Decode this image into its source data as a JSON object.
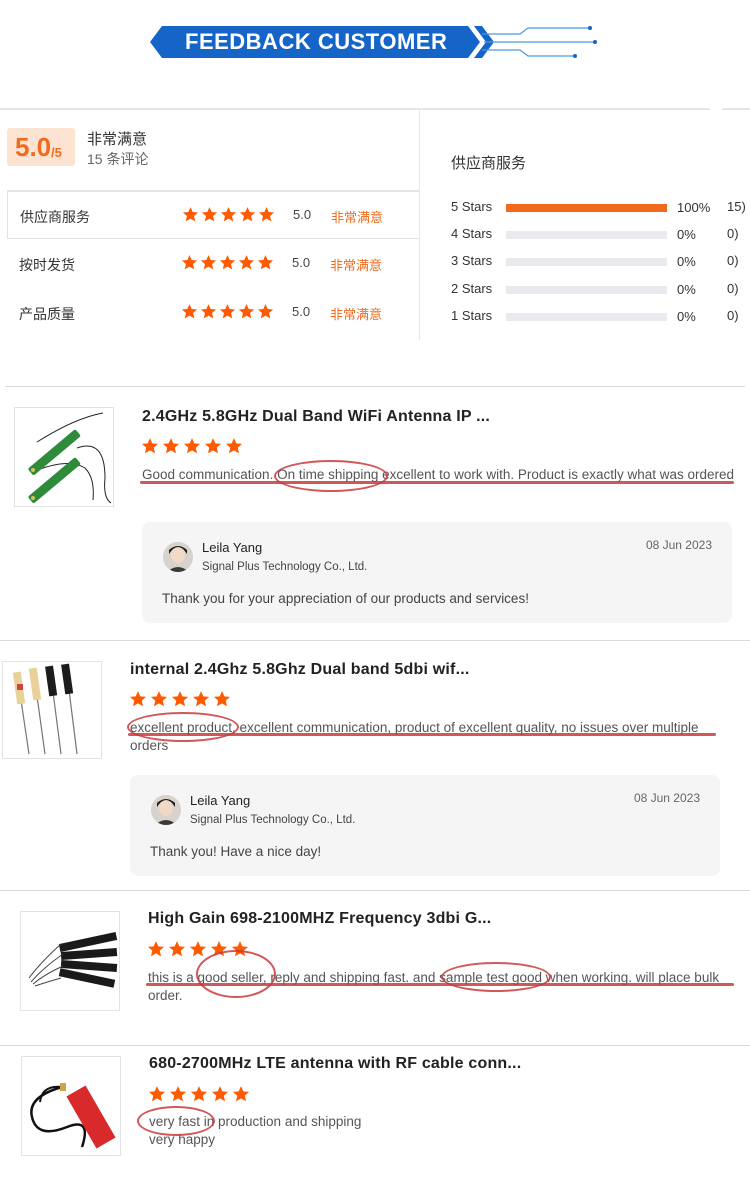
{
  "banner": {
    "title": "FEEDBACK CUSTOMER"
  },
  "summary": {
    "score": "5.0",
    "score_max": "/5",
    "rating_text": "非常满意",
    "review_count": "15 条评论"
  },
  "categories": [
    {
      "label": "供应商服务",
      "score": "5.0",
      "text": "非常满意",
      "stars": 5
    },
    {
      "label": "按时发货",
      "score": "5.0",
      "text": "非常满意",
      "stars": 5
    },
    {
      "label": "产品质量",
      "score": "5.0",
      "text": "非常满意",
      "stars": 5
    }
  ],
  "distribution": {
    "title": "供应商服务",
    "rows": [
      {
        "label": "5 Stars",
        "pct": "100%",
        "fraction": 1.0,
        "count_cut": "15)"
      },
      {
        "label": "4 Stars",
        "pct": "0%",
        "fraction": 0,
        "count_cut": "0)"
      },
      {
        "label": "3 Stars",
        "pct": "0%",
        "fraction": 0,
        "count_cut": "0)"
      },
      {
        "label": "2 Stars",
        "pct": "0%",
        "fraction": 0,
        "count_cut": "0)"
      },
      {
        "label": "1 Stars",
        "pct": "0%",
        "fraction": 0,
        "count_cut": "0)"
      }
    ]
  },
  "reviews": [
    {
      "title": "2.4GHz 5.8GHz Dual Band WiFi Antenna IP ...",
      "stars": 5,
      "text": "Good communication. On time shipping excellent to work with. Product is exactly what was ordered",
      "reply": {
        "name": "Leila Yang",
        "company": "Signal Plus Technology Co., Ltd.",
        "date": "08 Jun 2023",
        "text": "Thank you for your appreciation of our products and services!"
      }
    },
    {
      "title": "internal 2.4Ghz 5.8Ghz Dual band 5dbi wif...",
      "stars": 5,
      "text": "excellent product, excellent communication, product of excellent quality, no issues over multiple orders",
      "reply": {
        "name": "Leila Yang",
        "company": "Signal Plus Technology Co., Ltd.",
        "date": "08 Jun 2023",
        "text": "Thank you! Have a nice day!"
      }
    },
    {
      "title": "High Gain 698-2100MHZ Frequency 3dbi G...",
      "stars": 5,
      "text": "this is a good seller, reply and shipping fast. and sample test good when working. will place bulk order."
    },
    {
      "title": "680-2700MHz LTE antenna with RF cable conn...",
      "stars": 5,
      "text": "very fast in production and shipping very happy"
    }
  ],
  "colors": {
    "accent": "#f26b1d",
    "star": "#ff5a00",
    "banner": "#1565c8",
    "markup": "#c9393b"
  }
}
